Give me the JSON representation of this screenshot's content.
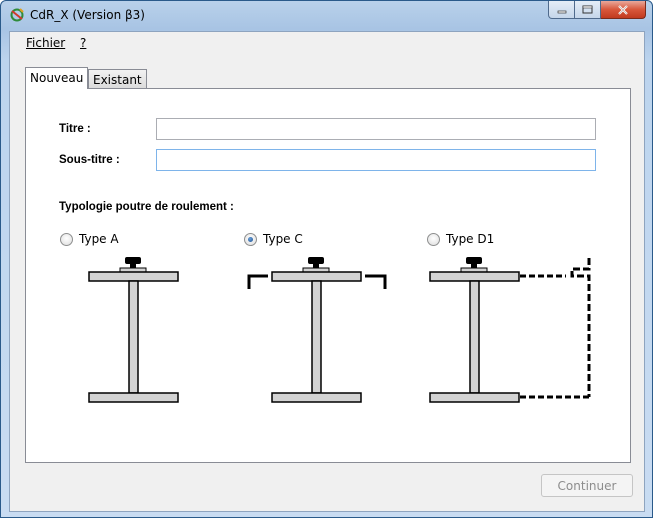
{
  "window": {
    "title": "CdR_X (Version β3)",
    "controls": {
      "minimize": "minimize-icon",
      "maximize": "maximize-icon",
      "close": "close-icon"
    }
  },
  "menu": {
    "items": [
      {
        "label": "Fichier"
      },
      {
        "label": "?"
      }
    ]
  },
  "tabs": [
    {
      "label": "Nouveau",
      "active": true
    },
    {
      "label": "Existant",
      "active": false
    }
  ],
  "form": {
    "titre_label": "Titre :",
    "titre_value": "",
    "soustitre_label": "Sous-titre :",
    "soustitre_value": "",
    "typologie_label": "Typologie poutre de roulement :"
  },
  "options": [
    {
      "label": "Type A",
      "checked": false
    },
    {
      "label": "Type C",
      "checked": true
    },
    {
      "label": "Type D1",
      "checked": false
    }
  ],
  "footer": {
    "continue_label": "Continuer",
    "continue_enabled": false
  },
  "colors": {
    "accent": "#1d4f8f",
    "beam_fill": "#d3d3d3",
    "close_button": "#c13a1f"
  }
}
